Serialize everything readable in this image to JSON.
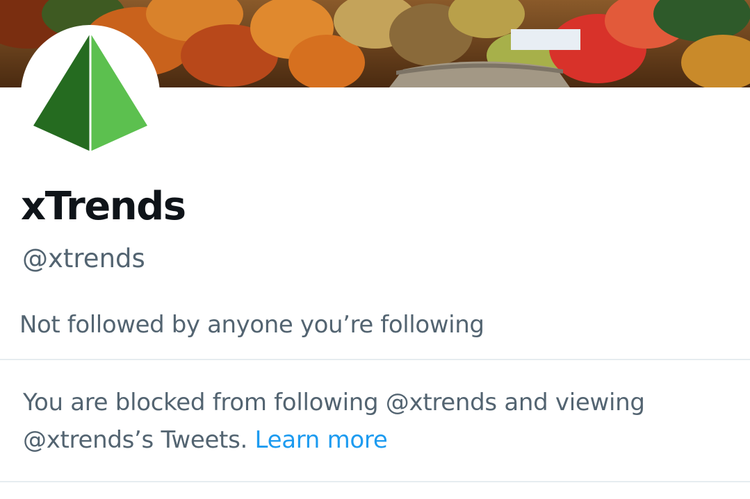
{
  "profile": {
    "display_name": "xTrends",
    "handle": "@xtrends",
    "followers_you_know": "Not followed by anyone you’re following",
    "avatar_icon": "green-pyramid-logo",
    "banner_image": "autumn-park-with-stone-bridge"
  },
  "blocked": {
    "line1": "You are blocked from following @xtrends and viewing",
    "line2": "@xtrends’s Tweets.",
    "learn_more": "Learn more"
  },
  "colors": {
    "primary_text": "#0f1419",
    "secondary_text": "#536471",
    "link": "#1d9bf0",
    "divider": "#e6ecf0",
    "avatar_dark_green": "#256b20",
    "avatar_light_green": "#5cc04f"
  }
}
